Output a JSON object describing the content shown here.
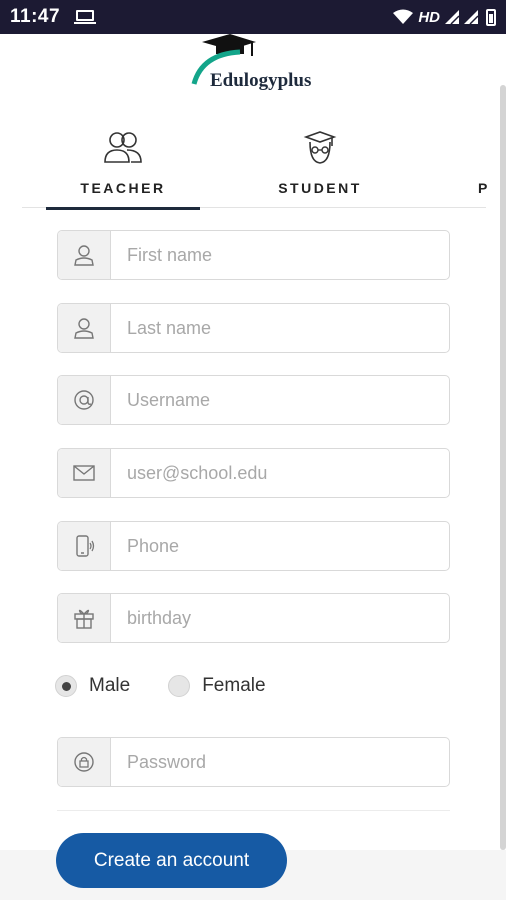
{
  "status_bar": {
    "time": "11:47",
    "network_label": "HD"
  },
  "logo": {
    "text": "Edulogyplus"
  },
  "tabs": [
    {
      "label": "TEACHER",
      "icon": "teacher-group-icon",
      "active": true
    },
    {
      "label": "STUDENT",
      "icon": "student-graduate-icon",
      "active": false
    },
    {
      "label": "P",
      "icon": "",
      "active": false
    }
  ],
  "form": {
    "first_name": {
      "placeholder": "First name",
      "icon": "user-icon"
    },
    "last_name": {
      "placeholder": "Last name",
      "icon": "user-icon"
    },
    "username": {
      "placeholder": "Username",
      "icon": "at-icon"
    },
    "email": {
      "placeholder": "user@school.edu",
      "icon": "envelope-icon"
    },
    "phone": {
      "placeholder": "Phone",
      "icon": "phone-icon"
    },
    "birthday": {
      "placeholder": "birthday",
      "icon": "gift-icon"
    },
    "gender": {
      "options": [
        "Male",
        "Female"
      ],
      "selected": "Male"
    },
    "password": {
      "placeholder": "Password",
      "icon": "lock-icon"
    }
  },
  "actions": {
    "create_account": "Create an account"
  },
  "colors": {
    "status_bar": "#1c1a33",
    "primary_button": "#165aa4",
    "tab_underline": "#1e2a3c"
  }
}
